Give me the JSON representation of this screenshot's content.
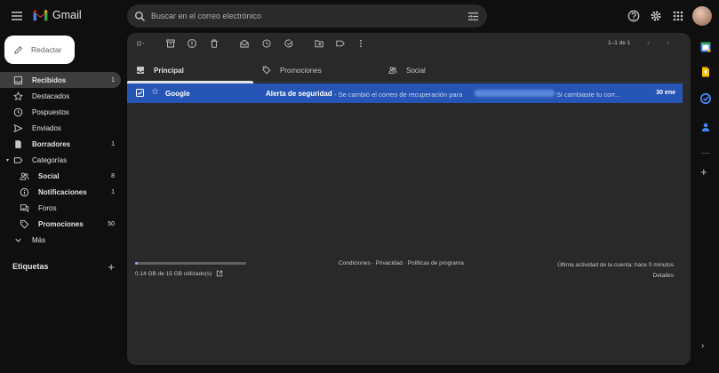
{
  "app": {
    "name": "Gmail"
  },
  "search": {
    "placeholder": "Buscar en el correo electrónico"
  },
  "compose": {
    "label": "Redactar"
  },
  "sidebar": {
    "items": [
      {
        "label": "Recibidos",
        "count": "1",
        "icon": "inbox-icon",
        "active": true,
        "bold": true
      },
      {
        "label": "Destacados",
        "count": "",
        "icon": "star-icon"
      },
      {
        "label": "Pospuestos",
        "count": "",
        "icon": "clock-icon"
      },
      {
        "label": "Enviados",
        "count": "",
        "icon": "send-icon"
      },
      {
        "label": "Borradores",
        "count": "1",
        "icon": "draft-icon",
        "bold": true
      },
      {
        "label": "Categorías",
        "count": "",
        "icon": "label-icon"
      },
      {
        "label": "Social",
        "count": "8",
        "icon": "people-icon",
        "bold": true
      },
      {
        "label": "Notificaciones",
        "count": "1",
        "icon": "info-icon",
        "bold": true
      },
      {
        "label": "Foros",
        "count": "",
        "icon": "forum-icon"
      },
      {
        "label": "Promociones",
        "count": "50",
        "icon": "tag-icon",
        "bold": true
      },
      {
        "label": "Más",
        "count": "",
        "icon": "chevron-down-icon"
      }
    ],
    "labels_heading": "Etiquetas"
  },
  "toolbar": {
    "pager": "1–1 de 1"
  },
  "tabs": [
    {
      "label": "Principal",
      "icon": "inbox-icon",
      "active": true
    },
    {
      "label": "Promociones",
      "icon": "tag-icon"
    },
    {
      "label": "Social",
      "icon": "people-icon"
    }
  ],
  "emails": [
    {
      "sender": "Google",
      "subject": "Alerta de seguridad",
      "snippet_before": "- Se cambió el correo de recuperación para",
      "snippet_after": "Si cambiaste tu corr...",
      "date": "30 ene",
      "selected": true
    }
  ],
  "footer": {
    "storage": "0.14 GB de 15 GB utilizado(s)",
    "storage_fraction": 0.0093,
    "links": "Condiciones · Privacidad · Políticas de programa",
    "activity": "Última actividad de la cuenta: hace 0 minutos",
    "details": "Detalles"
  },
  "colors": {
    "selected_row": "#2755b5",
    "background": "#0f0f0f",
    "panel": "#292929"
  }
}
